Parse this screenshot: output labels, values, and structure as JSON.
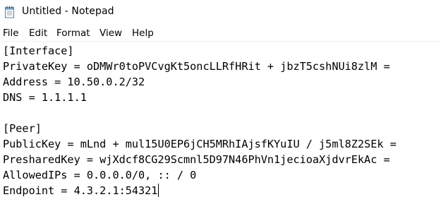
{
  "window": {
    "title": "Untitled - Notepad",
    "app_icon": "notepad-icon"
  },
  "menu": {
    "items": [
      "File",
      "Edit",
      "Format",
      "View",
      "Help"
    ]
  },
  "editor": {
    "lines": [
      "[Interface]",
      "PrivateKey = oDMWr0toPVCvgKt5oncLLRfHRit + jbzT5cshNUi8zlM =",
      "Address = 10.50.0.2/32",
      "DNS = 1.1.1.1",
      "",
      "[Peer]",
      "PublicKey = mLnd + mul15U0EP6jCH5MRhIAjsfKYuIU / j5ml8Z2SEk =",
      "PresharedKey = wjXdcf8CG29Scmnl5D97N46PhVn1jecioaXjdvrEkAc =",
      "AllowedIPs = 0.0.0.0/0, :: / 0",
      "Endpoint = 4.3.2.1:54321"
    ]
  }
}
